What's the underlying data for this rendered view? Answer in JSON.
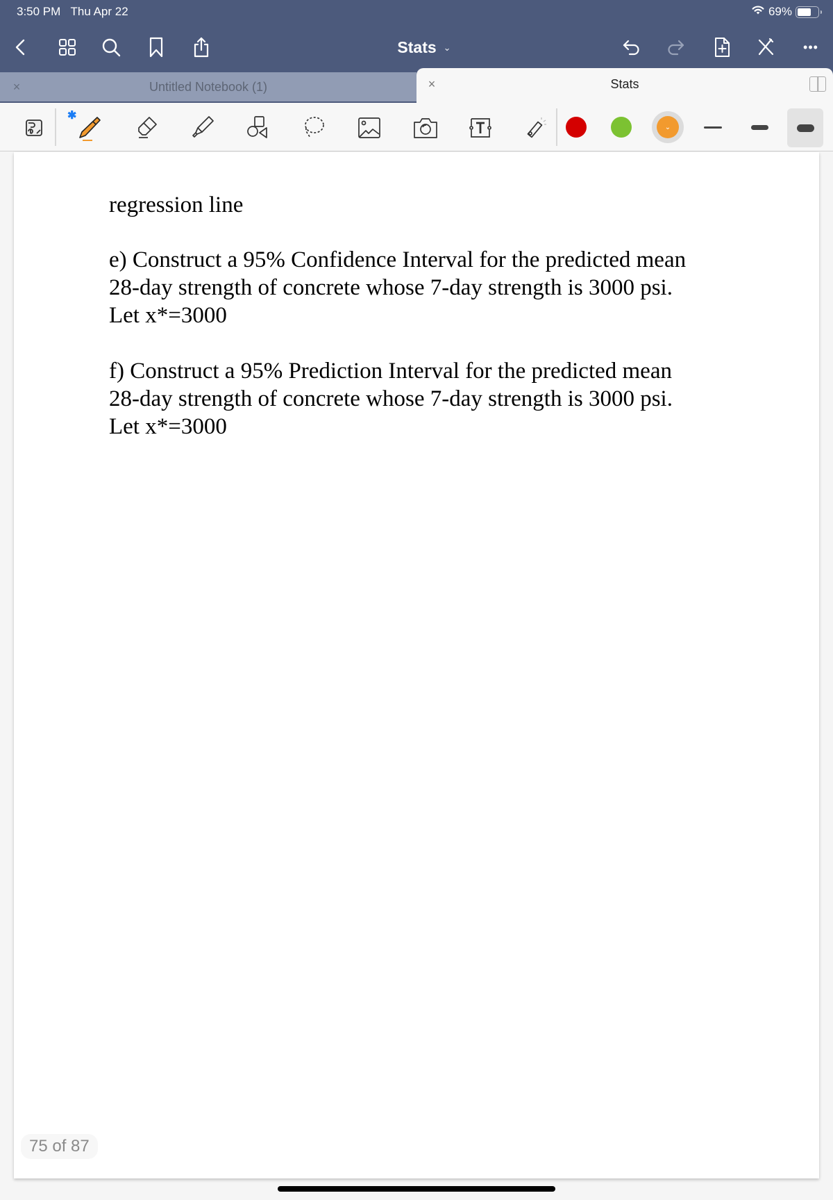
{
  "status_bar": {
    "time": "3:50 PM",
    "date": "Thu Apr 22",
    "battery_percent_text": "69%",
    "battery_level": 0.69,
    "wifi_icon": "wifi-icon"
  },
  "nav_bar": {
    "title": "Stats",
    "title_chevron": "chevron-down-icon",
    "left_icons": [
      "back-chevron-icon",
      "grid-view-icon",
      "search-icon",
      "bookmark-icon",
      "share-icon"
    ],
    "right_icons": [
      "undo-icon",
      "redo-icon",
      "add-page-icon",
      "pencil-off-icon",
      "more-icon"
    ],
    "more_glyph": "•••",
    "chevron_glyph": "⌄"
  },
  "tabs": [
    {
      "label": "Untitled Notebook (1)",
      "active": false,
      "close_glyph": "×"
    },
    {
      "label": "Stats",
      "active": true,
      "close_glyph": "×"
    }
  ],
  "toolbar": {
    "bluetooth_glyph": "✱",
    "tools": [
      "handwriting-text-icon",
      "pen-icon",
      "eraser-icon",
      "highlighter-icon",
      "shapes-icon",
      "lasso-icon",
      "image-icon",
      "camera-icon",
      "text-box-icon",
      "laser-pointer-icon"
    ],
    "selected_tool": "pen",
    "colors": [
      {
        "name": "red",
        "hex": "#d40000"
      },
      {
        "name": "green",
        "hex": "#7cc232"
      },
      {
        "name": "orange",
        "hex": "#f29a2e",
        "selected": true
      }
    ],
    "stroke_widths": [
      "thin",
      "medium",
      "thick"
    ],
    "selected_stroke": "thick",
    "accent_pen_color": "#f29a2e"
  },
  "document": {
    "heading_fragment": "regression line",
    "paragraph_e": [
      "e) Construct a 95% Confidence Interval for the predicted mean",
      "28-day strength of concrete whose 7-day strength is 3000 psi.",
      "Let x*=3000"
    ],
    "paragraph_f": [
      "f) Construct a 95% Prediction Interval for the predicted mean",
      "28-day strength of concrete whose 7-day strength is 3000 psi.",
      "Let x*=3000"
    ]
  },
  "page_indicator": "75 of 87"
}
